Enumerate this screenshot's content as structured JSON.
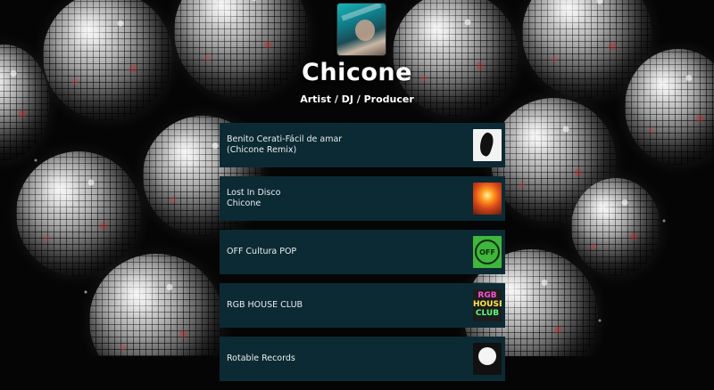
{
  "profile": {
    "name": "Chicone",
    "tagline": "Artist / DJ / Producer"
  },
  "links": [
    {
      "line1": "Benito Cerati-Fácil de amar",
      "line2": "(Chicone Remix)",
      "thumb_icon": "ink-splash-cover"
    },
    {
      "line1": "Lost In Disco",
      "line2": "Chicone",
      "thumb_icon": "fire-cover"
    },
    {
      "line1": "OFF Cultura POP",
      "line2": "",
      "thumb_icon": "off-logo",
      "thumb_text": "OFF"
    },
    {
      "line1": "RGB HOUSE CLUB",
      "line2": "",
      "thumb_icon": "rgb-house-club-logo",
      "thumb_lines": [
        "RGB",
        "HOUSE",
        "CLUB"
      ]
    },
    {
      "line1": "Rotable Records",
      "line2": "",
      "thumb_icon": "record-logo"
    }
  ],
  "colors": {
    "link_background": "#0c2a33",
    "link_text": "#e8eef0",
    "page_background": "#050505"
  }
}
